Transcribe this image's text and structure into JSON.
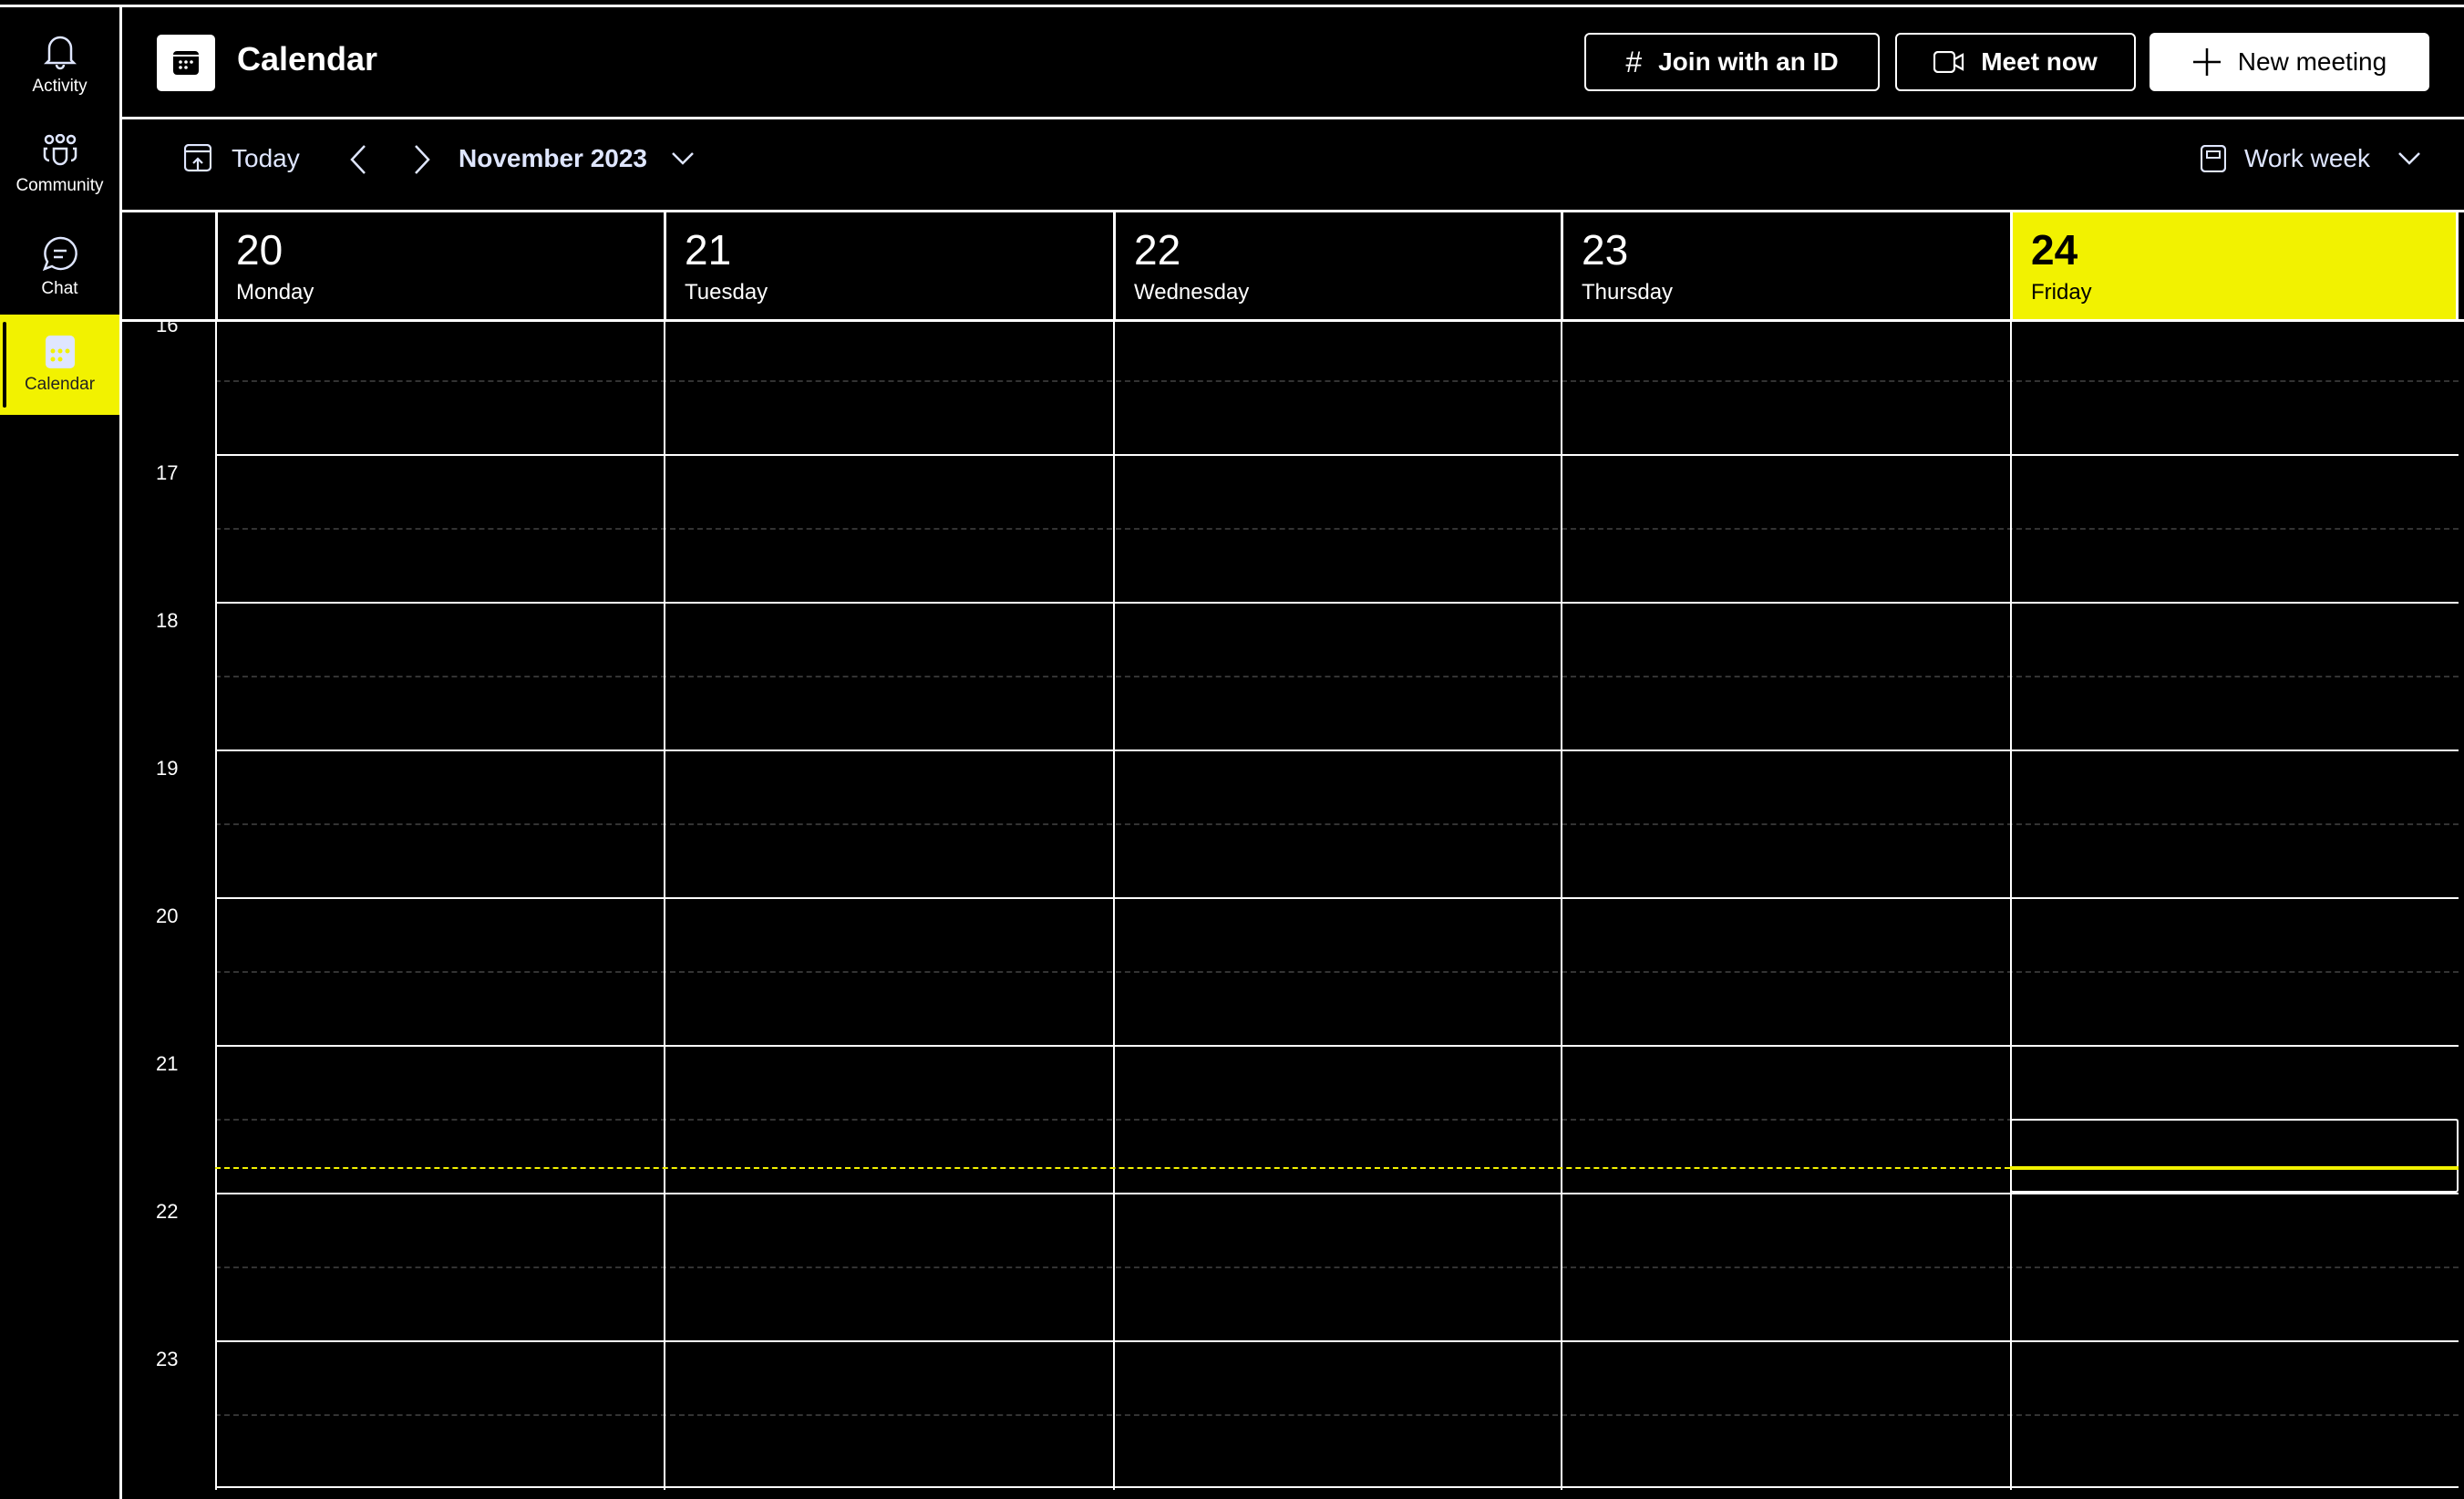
{
  "sidebar": {
    "items": [
      {
        "label": "Activity",
        "icon": "bell-icon"
      },
      {
        "label": "Community",
        "icon": "community-icon"
      },
      {
        "label": "Chat",
        "icon": "chat-icon"
      },
      {
        "label": "Calendar",
        "icon": "calendar-icon",
        "active": true
      }
    ]
  },
  "header": {
    "title": "Calendar",
    "join_label": "Join with an ID",
    "meet_label": "Meet now",
    "new_label": "New meeting"
  },
  "toolbar": {
    "today_label": "Today",
    "month_label": "November 2023",
    "view_label": "Work week"
  },
  "days": [
    {
      "num": "20",
      "name": "Monday"
    },
    {
      "num": "21",
      "name": "Tuesday"
    },
    {
      "num": "22",
      "name": "Wednesday"
    },
    {
      "num": "23",
      "name": "Thursday"
    },
    {
      "num": "24",
      "name": "Friday",
      "today": true
    }
  ],
  "hours": [
    "16",
    "17",
    "18",
    "19",
    "20",
    "21",
    "22",
    "23"
  ],
  "current_time_hour": 21.83,
  "colors": {
    "accent": "#f2f200",
    "background": "#000000"
  }
}
